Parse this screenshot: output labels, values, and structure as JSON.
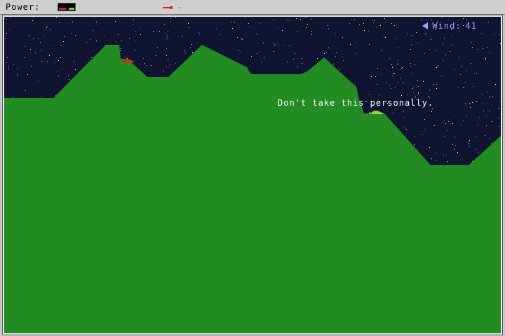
{
  "topbar": {
    "power_label": "Power:",
    "power_level": 0.85
  },
  "hud": {
    "wind_label": "Wind:",
    "wind_value": "41",
    "wind_direction": "left",
    "taunt_text": "Don't take this personally."
  },
  "colors": {
    "sky": "#0f1430",
    "terrain": "#228b22",
    "player_tank": "#e02020",
    "enemy_tank": "#9ad03a",
    "wind_text": "#9fa4ff"
  },
  "entities": {
    "player_tank": {
      "color_name": "red"
    },
    "enemy_tank": {
      "color_name": "green"
    }
  }
}
